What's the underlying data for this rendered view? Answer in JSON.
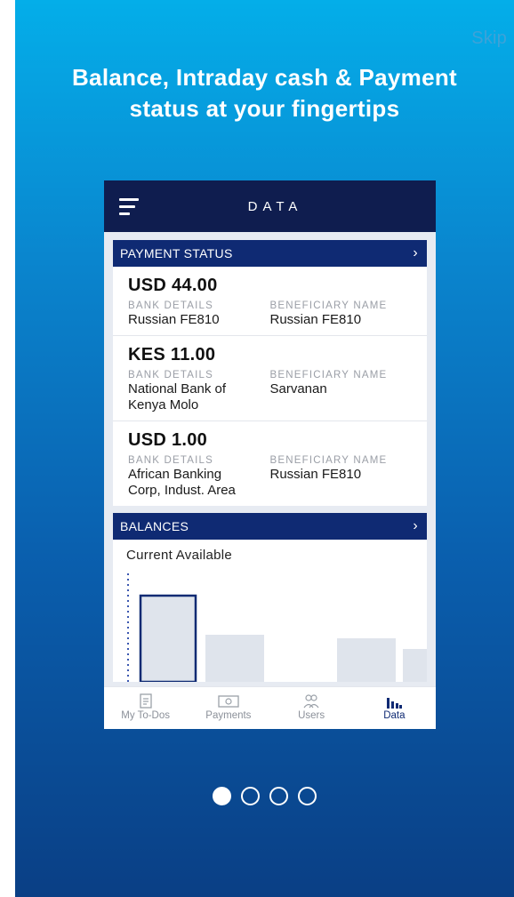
{
  "skip_label": "Skip",
  "headline_line1": "Balance, Intraday cash & Payment",
  "headline_line2": "status at your fingertips",
  "phone": {
    "title": "DATA",
    "payment_status": {
      "header": "PAYMENT STATUS",
      "bank_label": "BANK DETAILS",
      "beneficiary_label": "BENEFICIARY NAME",
      "items": [
        {
          "amount": "USD 44.00",
          "bank_line1": "Russian FE810",
          "bank_line2": "",
          "beneficiary": "Russian FE810"
        },
        {
          "amount": "KES 11.00",
          "bank_line1": "National Bank of",
          "bank_line2": "Kenya Molo",
          "beneficiary": "Sarvanan"
        },
        {
          "amount": "USD 1.00",
          "bank_line1": "African Banking",
          "bank_line2": "Corp, Indust. Area",
          "beneficiary": "Russian FE810"
        }
      ]
    },
    "balances": {
      "header": "BALANCES",
      "label": "Current Available"
    },
    "tabs": [
      {
        "label": "My To-Dos",
        "icon": "todo-icon",
        "active": false
      },
      {
        "label": "Payments",
        "icon": "payments-icon",
        "active": false
      },
      {
        "label": "Users",
        "icon": "users-icon",
        "active": false
      },
      {
        "label": "Data",
        "icon": "data-icon",
        "active": true
      }
    ]
  },
  "pagination": {
    "pages": 4,
    "current": 1
  },
  "colors": {
    "navy": "#0f1d4f",
    "section_header": "#0f2a73",
    "gradient_top": "#04aee9",
    "gradient_bottom": "#0a3f85"
  }
}
